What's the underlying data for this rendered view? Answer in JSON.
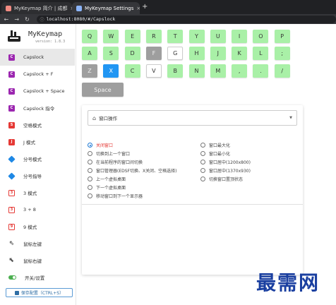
{
  "browser": {
    "tabs": [
      {
        "title": "MyKeymap 简介 | 成都"
      },
      {
        "title": "MyKeymap Settings"
      }
    ],
    "new_tab_label": "+",
    "close_label": "×",
    "url": "localhost:8080/#/Capslock",
    "nav": {
      "back": "←",
      "forward": "→",
      "reload": "↻"
    }
  },
  "sidebar": {
    "app_name": "MyKeymap",
    "version": "version: 1.8.3",
    "items": [
      {
        "label": "Capslock",
        "icon": "c-purple-icon",
        "glyph": "C"
      },
      {
        "label": "Capslock + F",
        "icon": "c-purple-icon",
        "glyph": "C"
      },
      {
        "label": "Capslock + Space",
        "icon": "c-purple-icon",
        "glyph": "C"
      },
      {
        "label": "Capslock 指令",
        "icon": "c-purple-icon",
        "glyph": "C"
      },
      {
        "label": "空格模式",
        "icon": "s-red-icon",
        "glyph": "S"
      },
      {
        "label": "J 模式",
        "icon": "j-red-icon",
        "glyph": "J"
      },
      {
        "label": "分号模式",
        "icon": "diamond-blue-icon",
        "glyph": ""
      },
      {
        "label": "分号指导",
        "icon": "diamond-blue-icon",
        "glyph": ""
      },
      {
        "label": "3 模式",
        "icon": "3-outline-icon",
        "glyph": "3"
      },
      {
        "label": "3 + 8",
        "icon": "3-outline-icon",
        "glyph": "3"
      },
      {
        "label": "9 模式",
        "icon": "9-outline-icon",
        "glyph": "9"
      },
      {
        "label": "鼠标左键",
        "icon": "cursor-outline-icon",
        "glyph": "⇖"
      },
      {
        "label": "鼠标右键",
        "icon": "cursor-filled-icon",
        "glyph": "⬉"
      },
      {
        "label": "开关/设置",
        "icon": "toggle-icon",
        "glyph": ""
      }
    ],
    "save_button": "保存配置（CTRL+S）"
  },
  "keyboard": {
    "rows": [
      [
        {
          "k": "Q",
          "s": "green"
        },
        {
          "k": "W",
          "s": "green"
        },
        {
          "k": "E",
          "s": "green"
        },
        {
          "k": "R",
          "s": "green"
        },
        {
          "k": "T",
          "s": "green"
        },
        {
          "k": "Y",
          "s": "green"
        },
        {
          "k": "U",
          "s": "green"
        },
        {
          "k": "I",
          "s": "green"
        },
        {
          "k": "O",
          "s": "green"
        },
        {
          "k": "P",
          "s": "green"
        }
      ],
      [
        {
          "k": "A",
          "s": "green"
        },
        {
          "k": "S",
          "s": "green"
        },
        {
          "k": "D",
          "s": "green"
        },
        {
          "k": "F",
          "s": "gray"
        },
        {
          "k": "G",
          "s": "white"
        },
        {
          "k": "H",
          "s": "green"
        },
        {
          "k": "J",
          "s": "green"
        },
        {
          "k": "K",
          "s": "green"
        },
        {
          "k": "L",
          "s": "green"
        },
        {
          "k": ";",
          "s": "green"
        }
      ],
      [
        {
          "k": "Z",
          "s": "gray"
        },
        {
          "k": "X",
          "s": "blue"
        },
        {
          "k": "C",
          "s": "green"
        },
        {
          "k": "V",
          "s": "white"
        },
        {
          "k": "B",
          "s": "green"
        },
        {
          "k": "N",
          "s": "green"
        },
        {
          "k": "M",
          "s": "green"
        },
        {
          "k": ",",
          "s": "green"
        },
        {
          "k": ".",
          "s": "green"
        },
        {
          "k": "/",
          "s": "green"
        }
      ]
    ],
    "space": "Space"
  },
  "panel": {
    "select_value": "窗口操作",
    "select_icon": "home-icon",
    "options_left": [
      "关闭窗口",
      "切换到上一个窗口",
      "在当前程序的窗口间切换",
      "窗口管理器(EDSF切换、X关闭、空格选择)",
      "上一个虚拟桌面",
      "下一个虚拟桌面",
      "移动窗口到下一个显示器"
    ],
    "options_right": [
      "窗口最大化",
      "窗口最小化",
      "窗口居中(1200x800)",
      "窗口居中(1370x930)",
      "切换窗口置顶状态"
    ],
    "selected": "关闭窗口"
  },
  "watermark": "最需网",
  "colors": {
    "key_green": "#a9f0a7",
    "key_gray": "#9e9e9e",
    "key_blue": "#2196f3",
    "accent": "#1976d2",
    "selected_text": "#e53935"
  }
}
